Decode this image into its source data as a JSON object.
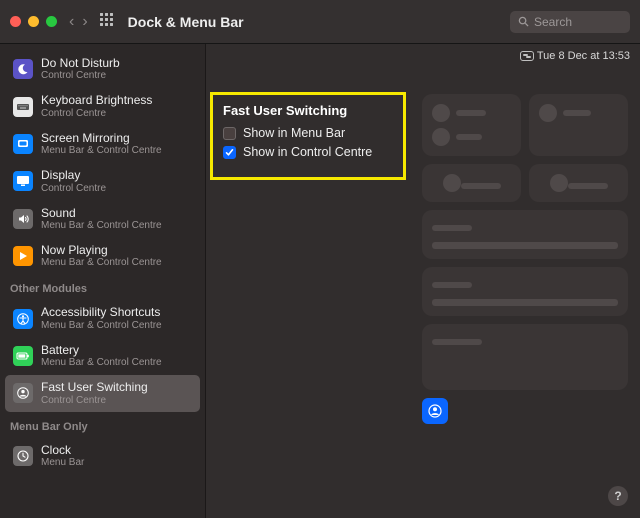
{
  "titlebar": {
    "title": "Dock & Menu Bar",
    "search_placeholder": "Search"
  },
  "clock": "Tue 8 Dec at  13:53",
  "sidebar": {
    "groups": [
      {
        "items": [
          {
            "label": "Do Not Disturb",
            "sub": "Control Centre",
            "icon": "moon",
            "bg": "#5b53c7"
          },
          {
            "label": "Keyboard Brightness",
            "sub": "Control Centre",
            "icon": "kbd",
            "bg": "#e8e8e8"
          },
          {
            "label": "Screen Mirroring",
            "sub": "Menu Bar & Control Centre",
            "icon": "mirror",
            "bg": "#0a84ff"
          },
          {
            "label": "Display",
            "sub": "Control Centre",
            "icon": "display",
            "bg": "#0a84ff"
          },
          {
            "label": "Sound",
            "sub": "Menu Bar & Control Centre",
            "icon": "sound",
            "bg": "#6d6a6a"
          },
          {
            "label": "Now Playing",
            "sub": "Menu Bar & Control Centre",
            "icon": "play",
            "bg": "#ff9500"
          }
        ]
      },
      {
        "title": "Other Modules",
        "items": [
          {
            "label": "Accessibility Shortcuts",
            "sub": "Menu Bar & Control Centre",
            "icon": "access",
            "bg": "#0a84ff"
          },
          {
            "label": "Battery",
            "sub": "Menu Bar & Control Centre",
            "icon": "battery",
            "bg": "#30d158"
          },
          {
            "label": "Fast User Switching",
            "sub": "Control Centre",
            "icon": "user",
            "bg": "#6d6a6a",
            "selected": true
          }
        ]
      },
      {
        "title": "Menu Bar Only",
        "items": [
          {
            "label": "Clock",
            "sub": "Menu Bar",
            "icon": "clock",
            "bg": "#6d6a6a"
          }
        ]
      }
    ]
  },
  "panel": {
    "title": "Fast User Switching",
    "options": [
      {
        "label": "Show in Menu Bar",
        "checked": false
      },
      {
        "label": "Show in Control Centre",
        "checked": true
      }
    ]
  },
  "help": "?"
}
